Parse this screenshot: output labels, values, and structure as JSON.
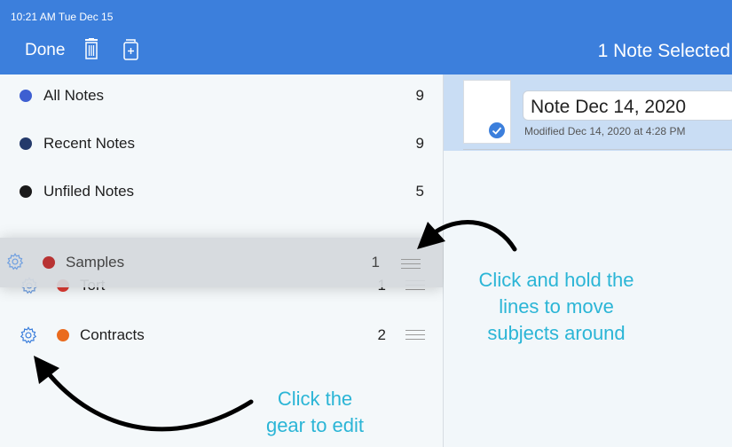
{
  "status": {
    "time_date": "10:21 AM   Tue Dec 15"
  },
  "toolbar": {
    "done_label": "Done",
    "trash_icon": "trash-icon",
    "add_icon": "add-note-icon"
  },
  "nav": {
    "title": "1 Note Selected"
  },
  "sidebar": {
    "rows": [
      {
        "label": "All Notes",
        "count": "9",
        "color": "#3e5fd1"
      },
      {
        "label": "Recent Notes",
        "count": "9",
        "color": "#243a6b"
      },
      {
        "label": "Unfiled Notes",
        "count": "5",
        "color": "#1a1a1a"
      }
    ],
    "subjects": [
      {
        "label": "Samples",
        "count": "1",
        "color": "#b83333",
        "state": "dragging"
      },
      {
        "label": "Tort",
        "count": "1",
        "color": "#dd3a33",
        "state": "covered"
      },
      {
        "label": "Contracts",
        "count": "2",
        "color": "#ea6b1e"
      }
    ]
  },
  "note": {
    "title": "Note Dec 14, 2020",
    "modified": "Modified Dec 14, 2020 at 4:28 PM",
    "selected": true
  },
  "annotations": {
    "drag_hint": [
      "Click and hold the",
      "lines to move",
      "subjects around"
    ],
    "gear_hint": [
      "Click the",
      "gear to edit"
    ]
  },
  "colors": {
    "accent": "#3c7fdc",
    "annotation": "#2bb5d6"
  }
}
